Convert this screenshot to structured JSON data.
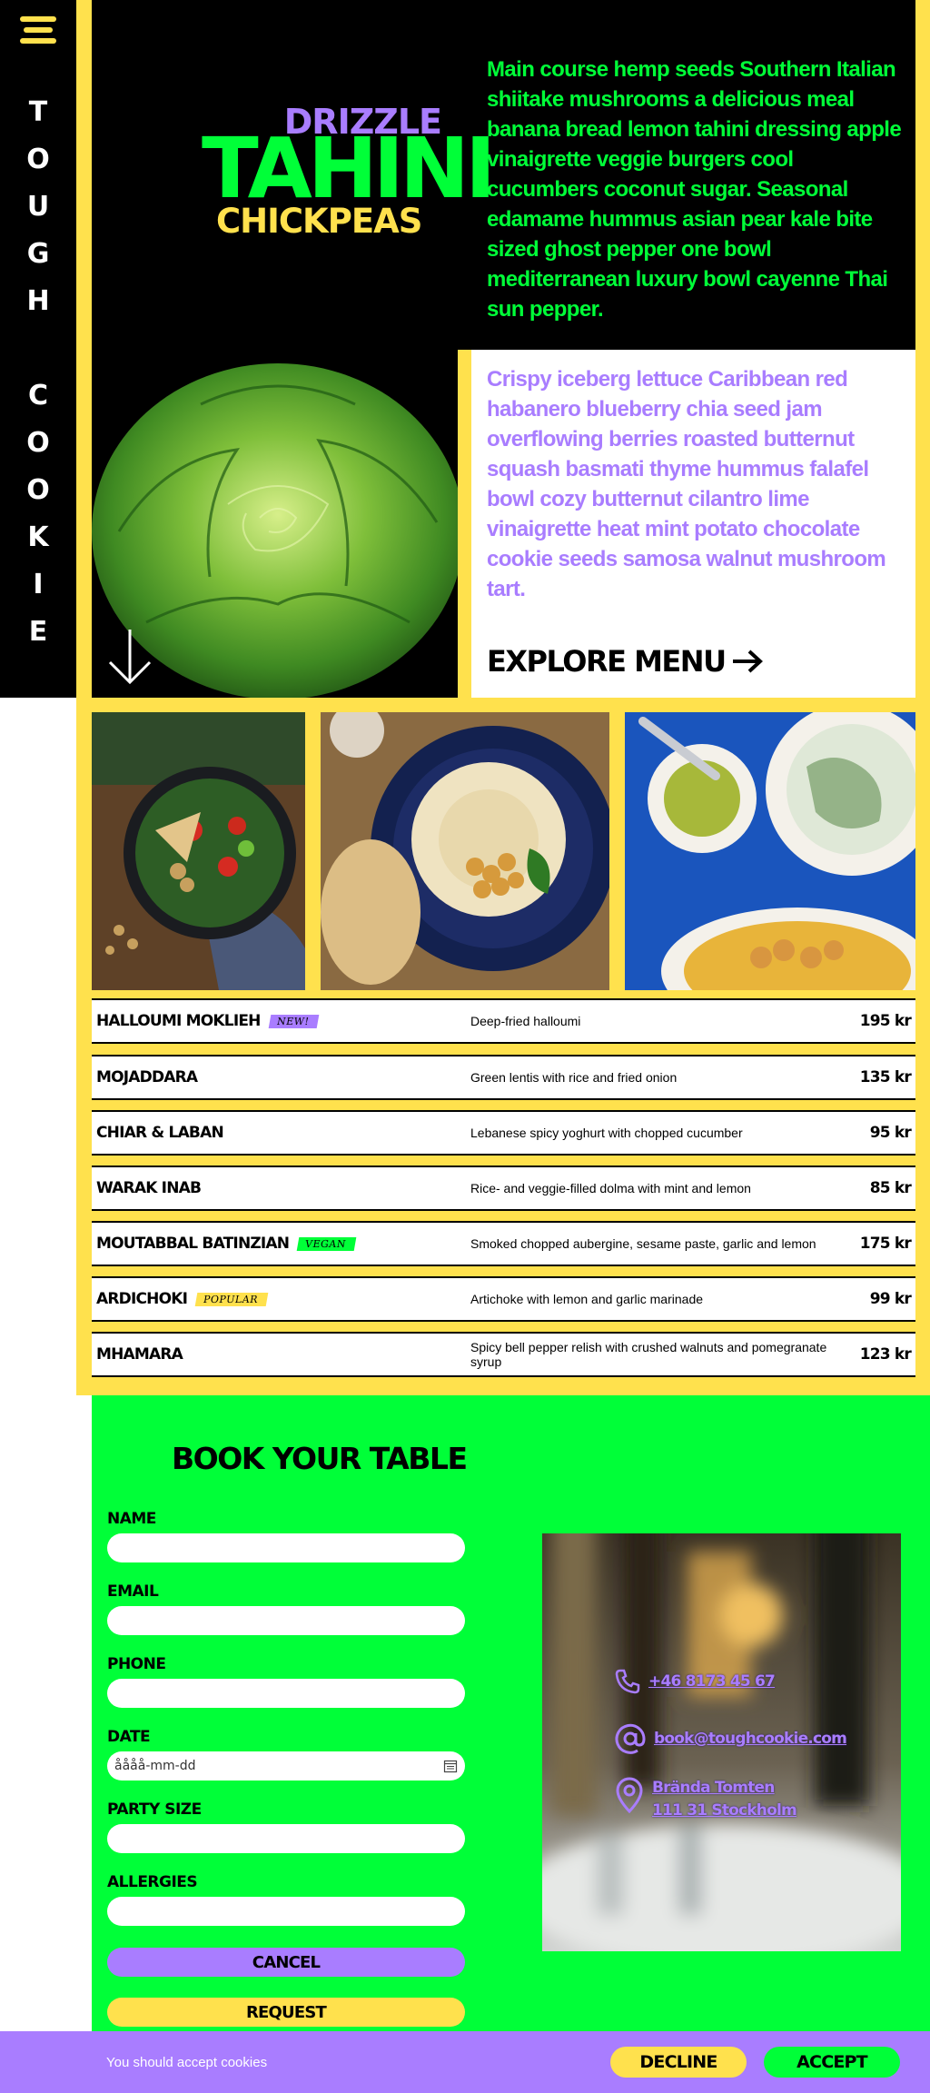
{
  "brand": {
    "name_letters": [
      "T",
      "O",
      "U",
      "G",
      "H",
      " ",
      "C",
      "O",
      "O",
      "K",
      "I",
      "E"
    ],
    "menu_icon": "hamburger-icon"
  },
  "hero": {
    "title_top": "DRIZZLE",
    "title_main": "TAHINI",
    "title_bottom": "CHICKPEAS",
    "intro": "Main course hemp seeds Southern Italian shiitake mushrooms a delicious meal banana bread lemon tahini dressing apple vinaigrette veggie burgers cool cucumbers coconut sugar. Seasonal edamame hummus asian pear kale bite sized ghost pepper one bowl mediterranean luxury bowl cayenne Thai sun pepper.",
    "scroll_icon": "arrow-down-icon"
  },
  "feature": {
    "text": "Crispy iceberg lettuce Caribbean red habanero blueberry chia seed jam overflowing berries roasted butternut squash basmati thyme hummus falafel bowl cozy butternut cilantro lime vinaigrette heat mint potato chocolate cookie seeds samosa walnut mushroom tart.",
    "cta_label": "EXPLORE MENU",
    "cta_icon": "arrow-right-icon"
  },
  "menu": {
    "items": [
      {
        "name": "HALLOUMI MOKLIEH",
        "badge": "NEW!",
        "badge_color": "#a97dff",
        "desc": "Deep-fried halloumi",
        "price": "195 kr"
      },
      {
        "name": "MOJADDARA",
        "badge": "",
        "badge_color": "",
        "desc": "Green lentis with rice and fried onion",
        "price": "135 kr"
      },
      {
        "name": "CHIAR & LABAN",
        "badge": "",
        "badge_color": "",
        "desc": "Lebanese spicy yoghurt with chopped cucumber",
        "price": "95 kr"
      },
      {
        "name": "WARAK INAB",
        "badge": "",
        "badge_color": "",
        "desc": "Rice- and veggie-filled dolma with mint and lemon",
        "price": "85 kr"
      },
      {
        "name": "MOUTABBAL BATINZIAN",
        "badge": "VEGAN",
        "badge_color": "#00ff38",
        "desc": "Smoked chopped aubergine, sesame paste, garlic and lemon",
        "price": "175 kr"
      },
      {
        "name": "ARDICHOKI",
        "badge": "POPULAR",
        "badge_color": "#ffe14d",
        "desc": "Artichoke with lemon and garlic marinade",
        "price": "99 kr"
      },
      {
        "name": "MHAMARA",
        "badge": "",
        "badge_color": "",
        "desc": "Spicy bell pepper relish with crushed walnuts and pomegranate syrup",
        "price": "123 kr"
      }
    ]
  },
  "booking": {
    "title": "BOOK YOUR TABLE",
    "fields": {
      "name": {
        "label": "NAME",
        "value": ""
      },
      "email": {
        "label": "EMAIL",
        "value": ""
      },
      "phone": {
        "label": "PHONE",
        "value": ""
      },
      "date": {
        "label": "DATE",
        "value": "åååå-mm-dd"
      },
      "party_size": {
        "label": "PARTY SIZE",
        "value": ""
      },
      "allergies": {
        "label": "ALLERGIES",
        "value": ""
      }
    },
    "cancel_label": "CANCEL",
    "request_label": "REQUEST"
  },
  "contact": {
    "phone": "+46 8173 45 67",
    "email": "book@toughcookie.com",
    "address_line1": "Brända Tomten",
    "address_line2": "111 31 Stockholm"
  },
  "cookies": {
    "text": "You should accept cookies",
    "decline_label": "DECLINE",
    "accept_label": "ACCEPT"
  },
  "colors": {
    "yellow": "#ffe14d",
    "green": "#00ff38",
    "purple": "#a97dff",
    "black": "#000000"
  }
}
